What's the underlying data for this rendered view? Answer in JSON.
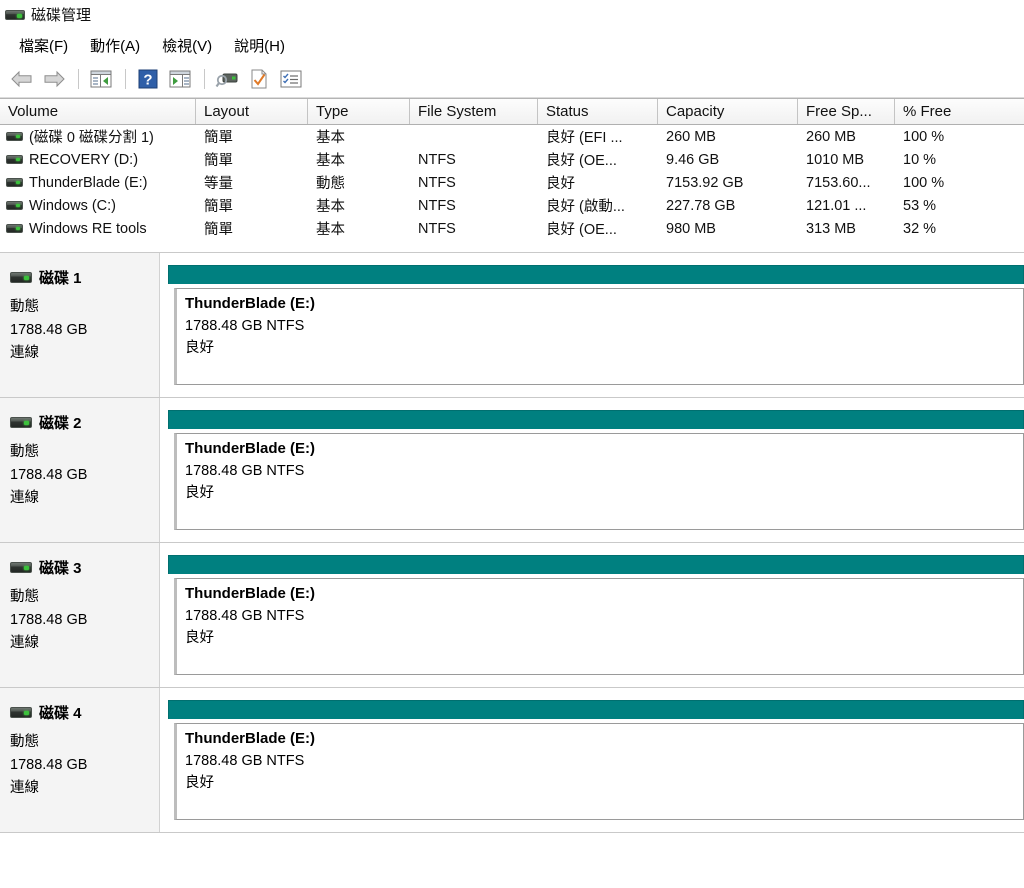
{
  "window": {
    "title": "磁碟管理",
    "icon": "disk-drive-icon"
  },
  "menubar": {
    "items": [
      {
        "label": "檔案(F)",
        "name": "menu-file"
      },
      {
        "label": "動作(A)",
        "name": "menu-action"
      },
      {
        "label": "檢視(V)",
        "name": "menu-view"
      },
      {
        "label": "說明(H)",
        "name": "menu-help"
      }
    ]
  },
  "toolbar": {
    "buttons": [
      {
        "icon": "back-arrow-icon",
        "name": "toolbar-back"
      },
      {
        "icon": "forward-arrow-icon",
        "name": "toolbar-forward"
      },
      {
        "icon": "show-console-tree-icon",
        "name": "toolbar-console-tree"
      },
      {
        "icon": "help-question-icon",
        "name": "toolbar-help"
      },
      {
        "icon": "show-action-pane-icon",
        "name": "toolbar-action-pane"
      },
      {
        "icon": "rescan-disks-icon",
        "name": "toolbar-rescan-disks"
      },
      {
        "icon": "document-check-icon",
        "name": "toolbar-properties"
      },
      {
        "icon": "checklist-icon",
        "name": "toolbar-show-list"
      }
    ]
  },
  "volume_table": {
    "columns": [
      "Volume",
      "Layout",
      "Type",
      "File System",
      "Status",
      "Capacity",
      "Free Sp...",
      "% Free"
    ],
    "rows": [
      {
        "volume": "(磁碟 0 磁碟分割 1)",
        "layout": "簡單",
        "type": "基本",
        "file_system": "",
        "status": "良好 (EFI ...",
        "capacity": "260 MB",
        "free_space": "260 MB",
        "percent_free": "100 %"
      },
      {
        "volume": "RECOVERY (D:)",
        "layout": "簡單",
        "type": "基本",
        "file_system": "NTFS",
        "status": "良好 (OE...",
        "capacity": "9.46 GB",
        "free_space": "1010 MB",
        "percent_free": "10 %"
      },
      {
        "volume": "ThunderBlade (E:)",
        "layout": "等量",
        "type": "動態",
        "file_system": "NTFS",
        "status": "良好",
        "capacity": "7153.92 GB",
        "free_space": "7153.60...",
        "percent_free": "100 %"
      },
      {
        "volume": "Windows (C:)",
        "layout": "簡單",
        "type": "基本",
        "file_system": "NTFS",
        "status": "良好 (啟動...",
        "capacity": "227.78 GB",
        "free_space": "121.01 ...",
        "percent_free": "53 %"
      },
      {
        "volume": "Windows RE tools",
        "layout": "簡單",
        "type": "基本",
        "file_system": "NTFS",
        "status": "良好 (OE...",
        "capacity": "980 MB",
        "free_space": "313 MB",
        "percent_free": "32 %"
      }
    ]
  },
  "disks": [
    {
      "name": "磁碟 1",
      "type": "動態",
      "capacity": "1788.48 GB",
      "status": "連線",
      "partition": {
        "label": "ThunderBlade  (E:)",
        "size_fs": "1788.48 GB NTFS",
        "state": "良好",
        "bar_color": "#008080"
      }
    },
    {
      "name": "磁碟 2",
      "type": "動態",
      "capacity": "1788.48 GB",
      "status": "連線",
      "partition": {
        "label": "ThunderBlade  (E:)",
        "size_fs": "1788.48 GB NTFS",
        "state": "良好",
        "bar_color": "#008080"
      }
    },
    {
      "name": "磁碟 3",
      "type": "動態",
      "capacity": "1788.48 GB",
      "status": "連線",
      "partition": {
        "label": "ThunderBlade  (E:)",
        "size_fs": "1788.48 GB NTFS",
        "state": "良好",
        "bar_color": "#008080"
      }
    },
    {
      "name": "磁碟 4",
      "type": "動態",
      "capacity": "1788.48 GB",
      "status": "連線",
      "partition": {
        "label": "ThunderBlade  (E:)",
        "size_fs": "1788.48 GB NTFS",
        "state": "良好",
        "bar_color": "#008080"
      }
    }
  ],
  "colors": {
    "teal_bar": "#008080",
    "header_bg": "#f1f1f1",
    "panel_bg": "#f4f4f4"
  }
}
